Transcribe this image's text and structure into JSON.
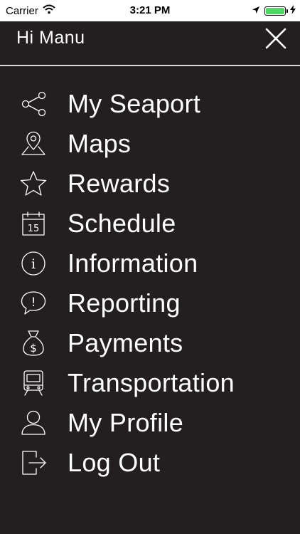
{
  "status_bar": {
    "carrier": "Carrier",
    "time": "3:21 PM",
    "battery_color": "#4cd964"
  },
  "header": {
    "greeting": "Hi Manu",
    "close_icon": "close-icon"
  },
  "colors": {
    "background": "#231f20",
    "text": "#ffffff",
    "divider": "#d9d9d9"
  },
  "menu": {
    "items": [
      {
        "label": "My Seaport",
        "icon": "share-network-icon"
      },
      {
        "label": "Maps",
        "icon": "map-pin-icon"
      },
      {
        "label": "Rewards",
        "icon": "star-icon"
      },
      {
        "label": "Schedule",
        "icon": "calendar-icon",
        "icon_text": "15"
      },
      {
        "label": "Information",
        "icon": "info-icon",
        "icon_text": "i"
      },
      {
        "label": "Reporting",
        "icon": "speech-bubble-alert-icon",
        "icon_text": "!"
      },
      {
        "label": "Payments",
        "icon": "money-bag-icon",
        "icon_text": "$"
      },
      {
        "label": "Transportation",
        "icon": "train-icon"
      },
      {
        "label": "My Profile",
        "icon": "user-icon"
      },
      {
        "label": "Log Out",
        "icon": "logout-icon"
      }
    ]
  }
}
